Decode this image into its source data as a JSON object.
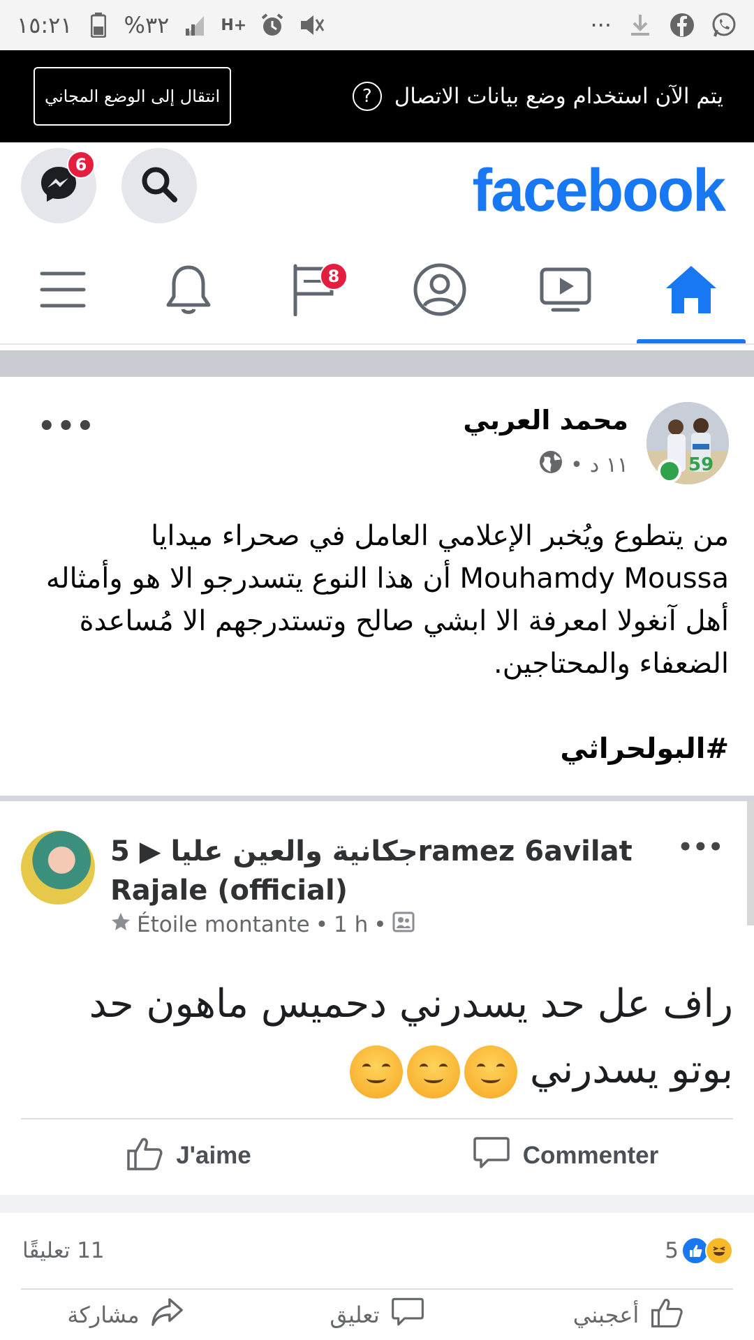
{
  "status_bar": {
    "time": "١٥:٢١",
    "battery": "%٣٢",
    "network": "H+",
    "more": "···"
  },
  "banner": {
    "message": "يتم الآن استخدام وضع بيانات الاتصال",
    "help": "?",
    "button_label": "انتقال إلى الوضع المجاني"
  },
  "header": {
    "logo": "facebook",
    "messenger_badge": "6"
  },
  "nav": {
    "pages_badge": "8",
    "active": "home"
  },
  "post": {
    "author": "محمد العربي",
    "time": "١١ د",
    "separator": "•",
    "text": "من يتطوع ويُخبر الإعلامي العامل في صحراء ميدايا Mouhamdy Moussa أن هذا النوع يتسدرجو الا هو وأمثاله أهل آنغولا امعرفة الا ابشي صالح وتستدرجهم الا مُساعدة الضعفاء والمحتاجين.",
    "hashtag": "#البولحراثي",
    "more": "•••"
  },
  "shared": {
    "title": "جكانية والعين عليا ▶ 5ramez 6avilat Rajale (official)",
    "badge_label": "Étoile montante",
    "time": "1 h",
    "dot": "•",
    "body": "راف عل حد يسدرني دحميس ماهون حد بوتو يسدرني",
    "more": "•••",
    "like_label": "J'aime",
    "comment_label": "Commenter"
  },
  "stats": {
    "reactions_count": "5",
    "comments_count": "11 تعليقًا"
  },
  "actions": {
    "like": "أعجبني",
    "comment": "تعليق",
    "share": "مشاركة"
  },
  "colors": {
    "brand": "#1877f2",
    "badge": "#e41e3f",
    "online": "#31a24c"
  }
}
